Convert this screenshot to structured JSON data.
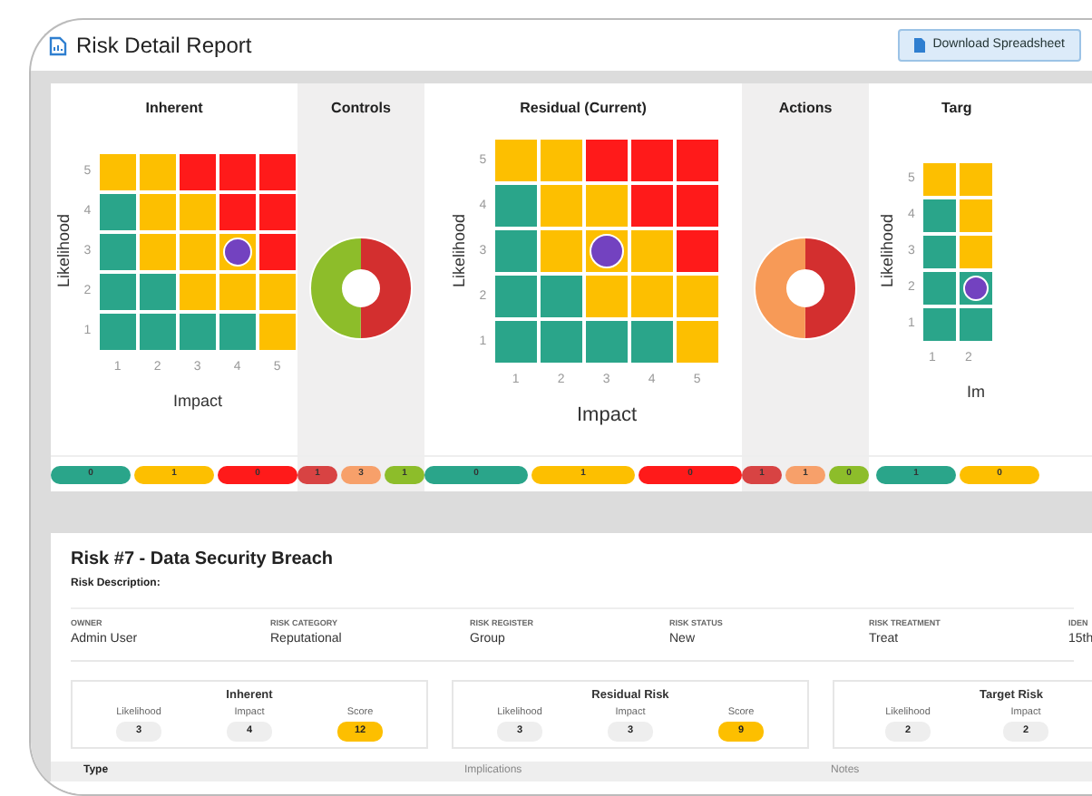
{
  "header": {
    "title": "Risk Detail Report",
    "download_button": "Download Spreadsheet"
  },
  "panels": [
    {
      "kind": "heatmap",
      "title": "Inherent",
      "ylabel": "Likelihood",
      "xlabel": "Impact",
      "yticks": [
        "5",
        "4",
        "3",
        "2",
        "1"
      ],
      "xticks": [
        "1",
        "2",
        "3",
        "4",
        "5"
      ],
      "rows": [
        {
          "cells": [
            {
              "color": "#fdbf00",
              "selected": false
            },
            {
              "color": "#fdbf00",
              "selected": false
            },
            {
              "color": "#ff1a1a",
              "selected": false
            },
            {
              "color": "#ff1a1a",
              "selected": false
            },
            {
              "color": "#ff1a1a",
              "selected": false
            }
          ]
        },
        {
          "cells": [
            {
              "color": "#2aa58a",
              "selected": false
            },
            {
              "color": "#fdbf00",
              "selected": false
            },
            {
              "color": "#fdbf00",
              "selected": false
            },
            {
              "color": "#ff1a1a",
              "selected": false
            },
            {
              "color": "#ff1a1a",
              "selected": false
            }
          ]
        },
        {
          "cells": [
            {
              "color": "#2aa58a",
              "selected": false
            },
            {
              "color": "#fdbf00",
              "selected": false
            },
            {
              "color": "#fdbf00",
              "selected": false
            },
            {
              "color": "#fdbf00",
              "selected": true
            },
            {
              "color": "#ff1a1a",
              "selected": false
            }
          ]
        },
        {
          "cells": [
            {
              "color": "#2aa58a",
              "selected": false
            },
            {
              "color": "#2aa58a",
              "selected": false
            },
            {
              "color": "#fdbf00",
              "selected": false
            },
            {
              "color": "#fdbf00",
              "selected": false
            },
            {
              "color": "#fdbf00",
              "selected": false
            }
          ]
        },
        {
          "cells": [
            {
              "color": "#2aa58a",
              "selected": false
            },
            {
              "color": "#2aa58a",
              "selected": false
            },
            {
              "color": "#2aa58a",
              "selected": false
            },
            {
              "color": "#2aa58a",
              "selected": false
            },
            {
              "color": "#fdbf00",
              "selected": false
            }
          ]
        }
      ],
      "pills": [
        {
          "text": "0",
          "color": "#2aa58a"
        },
        {
          "text": "1",
          "color": "#fdbf00"
        },
        {
          "text": "0",
          "color": "#ff1a1a"
        }
      ]
    },
    {
      "kind": "donut",
      "title": "Controls",
      "segments": [
        {
          "color": "#d32f2f"
        },
        {
          "color": "#8dbd2a"
        }
      ],
      "pills": [
        {
          "text": "1",
          "color": "#d84343"
        },
        {
          "text": "3",
          "color": "#f7a06a"
        },
        {
          "text": "1",
          "color": "#8dbd2a"
        }
      ]
    },
    {
      "kind": "heatmap",
      "title": "Residual (Current)",
      "ylabel": "Likelihood",
      "xlabel": "Impact",
      "yticks": [
        "5",
        "4",
        "3",
        "2",
        "1"
      ],
      "xticks": [
        "1",
        "2",
        "3",
        "4",
        "5"
      ],
      "rows": [
        {
          "cells": [
            {
              "color": "#fdbf00",
              "selected": false
            },
            {
              "color": "#fdbf00",
              "selected": false
            },
            {
              "color": "#ff1a1a",
              "selected": false
            },
            {
              "color": "#ff1a1a",
              "selected": false
            },
            {
              "color": "#ff1a1a",
              "selected": false
            }
          ]
        },
        {
          "cells": [
            {
              "color": "#2aa58a",
              "selected": false
            },
            {
              "color": "#fdbf00",
              "selected": false
            },
            {
              "color": "#fdbf00",
              "selected": false
            },
            {
              "color": "#ff1a1a",
              "selected": false
            },
            {
              "color": "#ff1a1a",
              "selected": false
            }
          ]
        },
        {
          "cells": [
            {
              "color": "#2aa58a",
              "selected": false
            },
            {
              "color": "#fdbf00",
              "selected": false
            },
            {
              "color": "#fdbf00",
              "selected": true
            },
            {
              "color": "#fdbf00",
              "selected": false
            },
            {
              "color": "#ff1a1a",
              "selected": false
            }
          ]
        },
        {
          "cells": [
            {
              "color": "#2aa58a",
              "selected": false
            },
            {
              "color": "#2aa58a",
              "selected": false
            },
            {
              "color": "#fdbf00",
              "selected": false
            },
            {
              "color": "#fdbf00",
              "selected": false
            },
            {
              "color": "#fdbf00",
              "selected": false
            }
          ]
        },
        {
          "cells": [
            {
              "color": "#2aa58a",
              "selected": false
            },
            {
              "color": "#2aa58a",
              "selected": false
            },
            {
              "color": "#2aa58a",
              "selected": false
            },
            {
              "color": "#2aa58a",
              "selected": false
            },
            {
              "color": "#fdbf00",
              "selected": false
            }
          ]
        }
      ],
      "pills": [
        {
          "text": "0",
          "color": "#2aa58a"
        },
        {
          "text": "1",
          "color": "#fdbf00"
        },
        {
          "text": "0",
          "color": "#ff1a1a"
        }
      ]
    },
    {
      "kind": "donut",
      "title": "Actions",
      "segments": [
        {
          "color": "#d32f2f"
        },
        {
          "color": "#f79a57"
        }
      ],
      "pills": [
        {
          "text": "1",
          "color": "#d84343"
        },
        {
          "text": "1",
          "color": "#f7a06a"
        },
        {
          "text": "0",
          "color": "#8dbd2a"
        }
      ]
    },
    {
      "kind": "heatmap",
      "title": "Targ",
      "ylabel": "Likelihood",
      "xlabel": "Im",
      "yticks": [
        "5",
        "4",
        "3",
        "2",
        "1"
      ],
      "xticks": [
        "1",
        "2"
      ],
      "rows": [
        {
          "cells": [
            {
              "color": "#fdbf00",
              "selected": false
            },
            {
              "color": "#fdbf00",
              "selected": false
            }
          ]
        },
        {
          "cells": [
            {
              "color": "#2aa58a",
              "selected": false
            },
            {
              "color": "#fdbf00",
              "selected": false
            }
          ]
        },
        {
          "cells": [
            {
              "color": "#2aa58a",
              "selected": false
            },
            {
              "color": "#fdbf00",
              "selected": false
            }
          ]
        },
        {
          "cells": [
            {
              "color": "#2aa58a",
              "selected": false
            },
            {
              "color": "#2aa58a",
              "selected": true
            }
          ]
        },
        {
          "cells": [
            {
              "color": "#2aa58a",
              "selected": false
            },
            {
              "color": "#2aa58a",
              "selected": false
            }
          ]
        }
      ],
      "pills": [
        {
          "text": "1",
          "color": "#2aa58a"
        },
        {
          "text": "0",
          "color": "#fdbf00"
        }
      ]
    }
  ],
  "risk": {
    "title": "Risk #7 - Data Security Breach",
    "description_label": "Risk Description:",
    "fields": [
      {
        "label": "OWNER",
        "value": "Admin User"
      },
      {
        "label": "RISK CATEGORY",
        "value": "Reputational"
      },
      {
        "label": "RISK REGISTER",
        "value": "Group"
      },
      {
        "label": "RISK STATUS",
        "value": "New"
      },
      {
        "label": "RISK TREATMENT",
        "value": "Treat"
      },
      {
        "label": "IDEN",
        "value": "15th"
      }
    ],
    "scores": [
      {
        "title": "Inherent",
        "items": [
          {
            "label": "Likelihood",
            "value": "3"
          },
          {
            "label": "Impact",
            "value": "4"
          },
          {
            "label": "Score",
            "value": "12",
            "color": "#fdbf00"
          }
        ]
      },
      {
        "title": "Residual Risk",
        "items": [
          {
            "label": "Likelihood",
            "value": "3"
          },
          {
            "label": "Impact",
            "value": "3"
          },
          {
            "label": "Score",
            "value": "9",
            "color": "#fdbf00"
          }
        ]
      },
      {
        "title": "Target Risk",
        "items": [
          {
            "label": "Likelihood",
            "value": "2"
          },
          {
            "label": "Impact",
            "value": "2"
          }
        ]
      }
    ],
    "table": {
      "columns": [
        "Type",
        "Implications",
        "Notes"
      ]
    }
  }
}
